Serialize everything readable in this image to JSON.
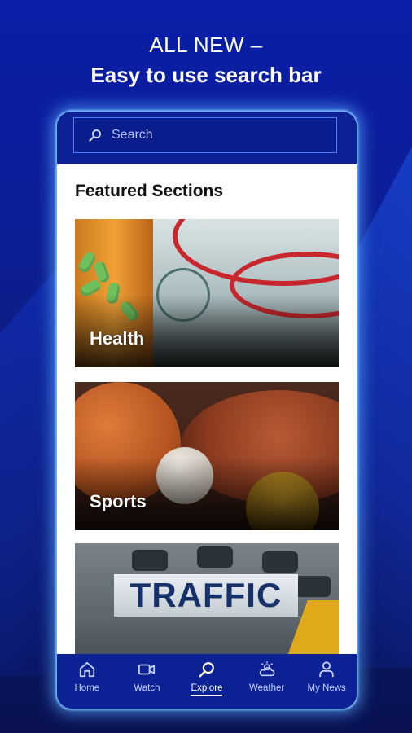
{
  "promo": {
    "line1": "ALL NEW –",
    "line2": "Easy to use search bar"
  },
  "search": {
    "placeholder": "Search"
  },
  "featured": {
    "title": "Featured Sections",
    "cards": [
      {
        "label": "Health"
      },
      {
        "label": "Sports"
      },
      {
        "label": "TRAFFIC"
      }
    ]
  },
  "tabs": [
    {
      "label": "Home",
      "icon": "home-icon"
    },
    {
      "label": "Watch",
      "icon": "video-camera-icon"
    },
    {
      "label": "Explore",
      "icon": "search-icon",
      "active": true
    },
    {
      "label": "Weather",
      "icon": "cloud-sun-icon"
    },
    {
      "label": "My News",
      "icon": "person-icon"
    }
  ],
  "colors": {
    "brand_blue": "#0b2194",
    "glow": "#5aaaff"
  }
}
